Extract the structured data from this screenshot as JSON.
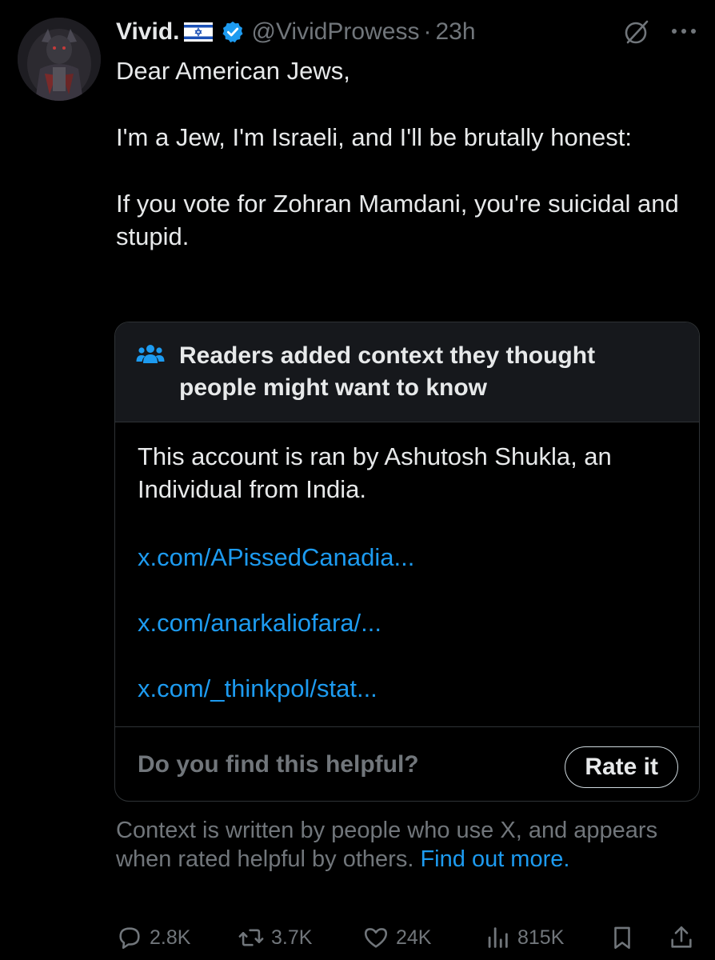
{
  "post": {
    "author_name": "Vivid.",
    "handle": "@VividProwess",
    "separator": "·",
    "time": "23h",
    "lines": [
      "Dear American Jews,",
      "I'm a Jew, I'm Israeli, and I'll be brutally honest:",
      "If you vote for Zohran Mamdani, you're suicidal and stupid."
    ]
  },
  "community_note": {
    "title": "Readers added context they thought people might want to know",
    "text": "This account is ran by Ashutosh Shukla, an Individual from India.",
    "links": [
      "x.com/APissedCanadia...",
      "x.com/anarkaliofara/...",
      "x.com/_thinkpol/stat..."
    ],
    "helpful_question": "Do you find this helpful?",
    "rate_label": "Rate it"
  },
  "context_caption": {
    "text": "Context is written by people who use X, and appears when rated helpful by others.",
    "link": "Find out more."
  },
  "actions": {
    "replies": "2.8K",
    "reposts": "3.7K",
    "likes": "24K",
    "views": "815K"
  },
  "colors": {
    "background": "#000000",
    "text": "#e7e9ea",
    "muted": "#71767b",
    "link": "#1d9bf0",
    "border": "#2f3336",
    "note_header_bg": "#16181c",
    "verified": "#1d9bf0"
  },
  "icons": {
    "verified": "verified-badge-icon",
    "flag": "israel-flag-icon",
    "grok": "grok-icon",
    "more": "more-options-icon",
    "people": "community-notes-people-icon",
    "reply": "reply-icon",
    "repost": "repost-icon",
    "like": "heart-icon",
    "views": "analytics-icon",
    "bookmark": "bookmark-icon",
    "share": "share-icon"
  }
}
